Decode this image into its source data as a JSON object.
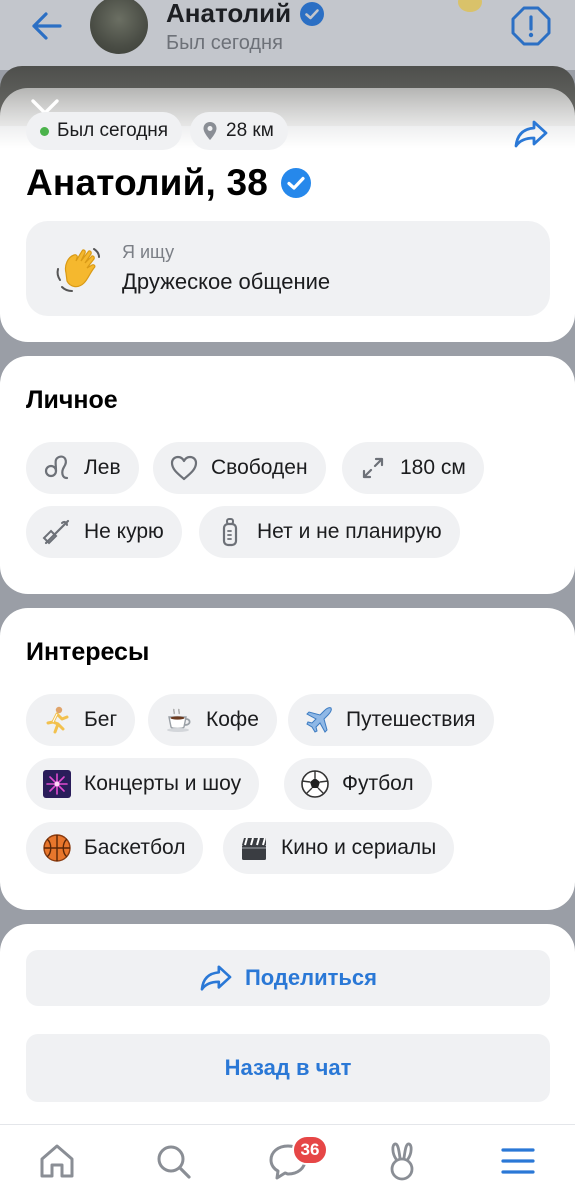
{
  "chat_header": {
    "name": "Анатолий",
    "status": "Был сегодня"
  },
  "profile": {
    "online_status": "Был сегодня",
    "distance": "28 км",
    "title": "Анатолий, 38",
    "looking_for": {
      "label": "Я ищу",
      "value": "Дружеское общение",
      "icon": "waving-hand-emoji"
    }
  },
  "personal": {
    "title": "Личное",
    "tags": [
      {
        "label": "Лев",
        "icon": "leo-zodiac-icon"
      },
      {
        "label": "Свободен",
        "icon": "heart-outline-icon"
      },
      {
        "label": "180 см",
        "icon": "height-arrows-icon"
      },
      {
        "label": "Не курю",
        "icon": "no-smoking-icon"
      },
      {
        "label": "Нет и не планирую",
        "icon": "baby-bottle-icon"
      }
    ]
  },
  "interests": {
    "title": "Интересы",
    "tags": [
      {
        "label": "Бег",
        "icon": "runner-emoji"
      },
      {
        "label": "Кофе",
        "icon": "coffee-emoji"
      },
      {
        "label": "Путешествия",
        "icon": "airplane-emoji"
      },
      {
        "label": "Концерты и шоу",
        "icon": "fireworks-emoji"
      },
      {
        "label": "Футбол",
        "icon": "soccer-ball-emoji"
      },
      {
        "label": "Баскетбол",
        "icon": "basketball-emoji"
      },
      {
        "label": "Кино и сериалы",
        "icon": "clapperboard-emoji"
      }
    ]
  },
  "actions": {
    "share_label": "Поделиться",
    "back_label": "Назад в чат"
  },
  "bottom_nav": {
    "messages_badge": "36"
  },
  "colors": {
    "accent": "#2a78d6",
    "verified": "#2688eb",
    "online": "#4bb34b",
    "badge": "#e64646",
    "chip_bg": "#f0f1f3"
  }
}
